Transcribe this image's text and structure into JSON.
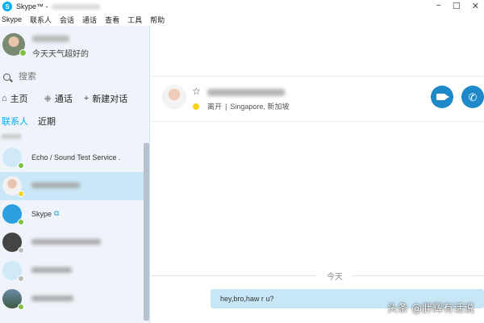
{
  "window": {
    "title": "Skype™ -",
    "controls": [
      "−",
      "☐",
      "✕"
    ]
  },
  "menu": {
    "items": [
      "Skype",
      "联系人",
      "会话",
      "通话",
      "查看",
      "工具",
      "帮助"
    ]
  },
  "profile": {
    "mood": "今天天气超好的",
    "status_color": "#7fc241"
  },
  "search": {
    "placeholder": "搜索"
  },
  "nav": {
    "home": "主页",
    "calls": "通话",
    "new_chat": "新建对话"
  },
  "tabs": {
    "contacts": "联系人",
    "recent": "近期"
  },
  "contacts": [
    {
      "name": "Echo / Sound Test Service .",
      "status": "online"
    },
    {
      "name": "",
      "status": "away",
      "selected": true
    },
    {
      "name": "Skype",
      "status": "online"
    },
    {
      "name": "",
      "status": "offline"
    },
    {
      "name": "",
      "status": "offline"
    },
    {
      "name": "",
      "status": "online"
    }
  ],
  "chat": {
    "status": "离开",
    "separator": "|",
    "location": "Singapore, 新加坡",
    "status_color": "#f7d417",
    "date_label": "今天",
    "message": "hey,bro,haw r u?"
  },
  "colors": {
    "accent": "#00aff0",
    "call_button": "#1d89c8",
    "sidebar_bg": "#eef4fa",
    "selected_row": "#c9e7f7",
    "bubble": "#c7e7f7"
  },
  "watermark": "头条 @胖辉有话说"
}
